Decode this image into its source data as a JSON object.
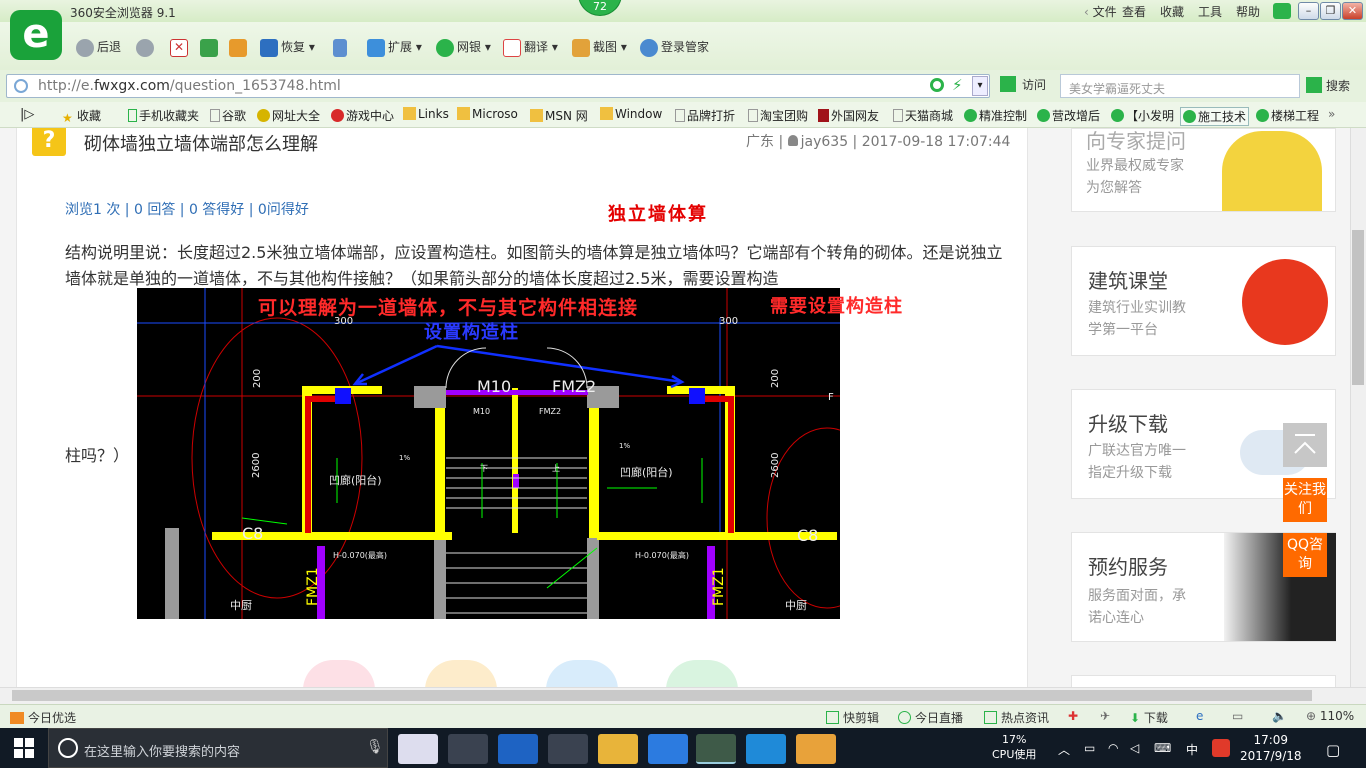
{
  "browser": {
    "title": "360安全浏览器 9.1",
    "badge": "72",
    "menus": [
      "文件",
      "查看",
      "收藏",
      "工具",
      "帮助"
    ],
    "toolbar": {
      "back": "后退",
      "restore": "恢复",
      "extend": "扩展",
      "bank": "网银",
      "translate": "翻译",
      "screenshot": "截图",
      "login_manager": "登录管家"
    },
    "url_prefix": "http://e.",
    "url_domain": "fwxgx.com",
    "url_path": "/question_1653748.html",
    "visit_label": "访问",
    "search_placeholder": "美女学霸逼死丈夫",
    "search_label": "搜索",
    "bookmarks": [
      "收藏",
      "手机收藏夹",
      "谷歌",
      "网址大全",
      "游戏中心",
      "Links",
      "Microso",
      "MSN 网",
      "Window",
      "品牌打折",
      "淘宝团购",
      "外国网友",
      "天猫商城",
      "精准控制",
      "营改增后",
      "【小发明",
      "施工技术",
      "楼梯工程"
    ]
  },
  "question": {
    "title": "砌体墙独立墙体端部怎么理解",
    "meta": "广东 | ",
    "user": "jay635",
    "timestamp": " | 2017-09-18 17:07:44",
    "stats": "浏览1 次 | 0 回答 | 0 答得好 | 0问得好",
    "body_line1": "结构说明里说：长度超过2.5米独立墙体端部，应设置构造柱。如图箭头的墙体算是独立墙体吗？它端部有个转角的砌体。还是说独立墙体就是单独的一道墙体，不与其他构件接触？（如果箭头部分的墙体长度超过2.5米，需要设置构造",
    "body_line2": "柱吗？）",
    "annotation_independent": "独立墙体算",
    "annotation_understand": "可以理解为一道墙体，不与其它构件相连接",
    "annotation_column": "设置构造柱",
    "annotation_need": "需要设置构造柱"
  },
  "drawing": {
    "labels": [
      "M10",
      "FMZ2",
      "凹廊(阳台)",
      "凹廊(阳台)",
      "中厨",
      "中厨",
      "C8",
      "C8",
      "2600",
      "2600",
      "300",
      "300",
      "200",
      "200",
      "H-0.070(最高)",
      "H-0.070(最高)",
      "FMZ1",
      "FMZ1",
      "F",
      "1%",
      "1%",
      "上",
      "下"
    ]
  },
  "sidebar": [
    {
      "title": "向专家提问",
      "sub1": "业界最权威专家",
      "sub2": "为您解答"
    },
    {
      "title": "建筑课堂",
      "sub1": "建筑行业实训教",
      "sub2": "学第一平台"
    },
    {
      "title": "升级下载",
      "sub1": "广联达官方唯一",
      "sub2": "指定升级下载"
    },
    {
      "title": "预约服务",
      "sub1": "服务面对面，承",
      "sub2": "诺心连心"
    }
  ],
  "float": {
    "follow": "关注我们",
    "qq": "QQ咨询"
  },
  "statusbar": {
    "left": "今日优选",
    "items": [
      "快剪辑",
      "今日直播",
      "热点资讯",
      "下载"
    ],
    "zoom": "110%"
  },
  "taskbar": {
    "search_placeholder": "在这里输入你要搜索的内容",
    "cpu_value": "17%",
    "cpu_label": "CPU使用",
    "ime": "中",
    "time": "17:09",
    "date": "2017/9/18"
  },
  "colors": {
    "accent_green": "#1aa23a",
    "annotation_red": "#e40000",
    "annotation_blue": "#2a3aff",
    "float_orange": "#ff6a00"
  }
}
